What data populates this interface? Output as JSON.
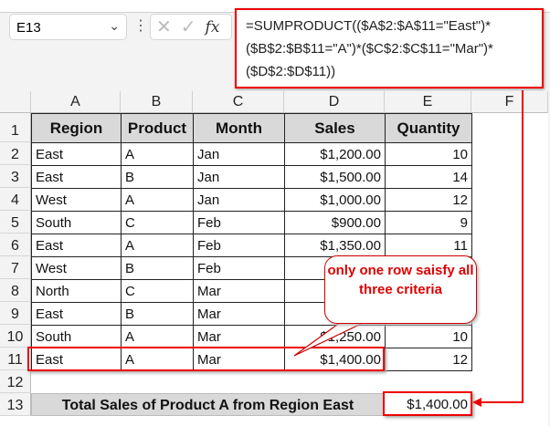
{
  "formula_bar": {
    "name_box": "E13",
    "formula": "=SUMPRODUCT(($A$2:$A$11=\"East\")*($B$2:$B$11=\"A\")*($C$2:$C$11=\"Mar\")*($D$2:$D$11))",
    "cancel_icon": "✕",
    "enter_icon": "✓",
    "fx_label": "fx"
  },
  "columns": [
    "A",
    "B",
    "C",
    "D",
    "E",
    "F"
  ],
  "rows": [
    "1",
    "2",
    "3",
    "4",
    "5",
    "6",
    "7",
    "8",
    "9",
    "10",
    "11",
    "12",
    "13"
  ],
  "table": {
    "headers": [
      "Region",
      "Product",
      "Month",
      "Sales",
      "Quantity"
    ],
    "data": [
      [
        "East",
        "A",
        "Jan",
        "$1,200.00",
        "10"
      ],
      [
        "East",
        "B",
        "Jan",
        "$1,500.00",
        "14"
      ],
      [
        "West",
        "A",
        "Jan",
        "$1,000.00",
        "12"
      ],
      [
        "South",
        "C",
        "Feb",
        "$900.00",
        "9"
      ],
      [
        "East",
        "A",
        "Feb",
        "$1,350.00",
        "11"
      ],
      [
        "West",
        "B",
        "Feb",
        "$",
        ""
      ],
      [
        "North",
        "C",
        "Mar",
        "",
        ""
      ],
      [
        "East",
        "B",
        "Mar",
        "$",
        ""
      ],
      [
        "South",
        "A",
        "Mar",
        "$1,250.00",
        "10"
      ],
      [
        "East",
        "A",
        "Mar",
        "$1,400.00",
        "12"
      ]
    ]
  },
  "total": {
    "label": "Total Sales of Product A from Region East",
    "value": "$1,400.00"
  },
  "callout": {
    "text": "only one row saisfy all three criteria"
  },
  "colors": {
    "accent": "#ee0000",
    "header_fill": "#d9d9d9"
  }
}
